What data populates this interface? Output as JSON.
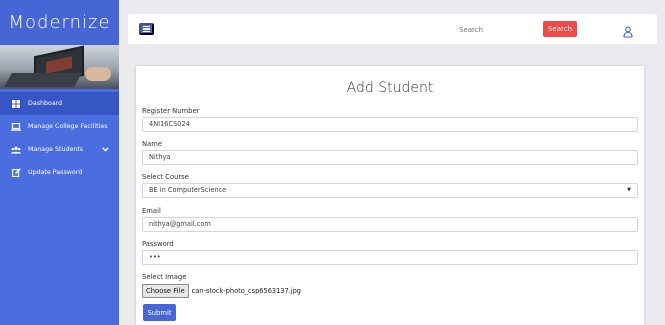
{
  "sidebar": {
    "brand": "Modernize",
    "items": [
      {
        "label": "Dashboard",
        "icon": "dashboard-icon",
        "active": true
      },
      {
        "label": "Manage College Facilities",
        "icon": "laptop-icon"
      },
      {
        "label": "Manage Students",
        "icon": "users-icon",
        "has_submenu": true
      },
      {
        "label": "Update Password",
        "icon": "edit-icon"
      }
    ]
  },
  "topbar": {
    "search_placeholder": "Search",
    "search_button": "Search",
    "user_icon": "user-icon"
  },
  "form": {
    "title": "Add Student",
    "register_label": "Register Number",
    "register_value": "4NI16CS024",
    "name_label": "Name",
    "name_value": "Nithya",
    "course_label": "Select Course",
    "course_value": "BE in ComputerScience",
    "email_label": "Email",
    "email_value": "nithya@gmail.com",
    "password_label": "Password",
    "password_value": "•••",
    "image_label": "Select Image",
    "choose_file": "Choose File",
    "file_name": "can-stock-photo_csp6563137.jpg",
    "submit": "Submit"
  },
  "colors": {
    "sidebar": "#4a6de0",
    "primary": "#4766d6",
    "search_button": "#ef4a4a"
  }
}
